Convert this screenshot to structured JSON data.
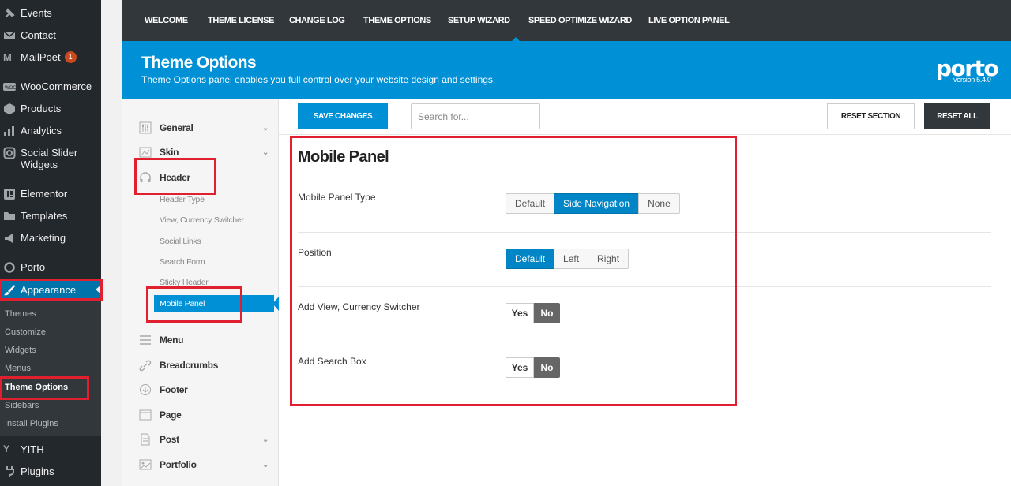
{
  "wp_menu": {
    "items": [
      {
        "label": "Events",
        "icon": "pin-icon"
      },
      {
        "label": "Contact",
        "icon": "mail-icon"
      },
      {
        "label": "MailPoet",
        "icon": "mailpoet-icon",
        "badge": "1"
      },
      {
        "label": "WooCommerce",
        "icon": "woocommerce-icon"
      },
      {
        "label": "Products",
        "icon": "box-icon"
      },
      {
        "label": "Analytics",
        "icon": "bar-chart-icon"
      },
      {
        "label": "Social Slider Widgets",
        "icon": "instagram-icon"
      },
      {
        "label": "Elementor",
        "icon": "elementor-icon"
      },
      {
        "label": "Templates",
        "icon": "folder-icon"
      },
      {
        "label": "Marketing",
        "icon": "megaphone-icon"
      },
      {
        "label": "Porto",
        "icon": "circle-icon"
      },
      {
        "label": "Appearance",
        "icon": "brush-icon"
      },
      {
        "label": "YITH",
        "icon": "yith-icon"
      },
      {
        "label": "Plugins",
        "icon": "plug-icon"
      }
    ],
    "submenu": [
      "Themes",
      "Customize",
      "Widgets",
      "Menus",
      "Theme Options",
      "Sidebars",
      "Install Plugins"
    ],
    "current_submenu": "Theme Options"
  },
  "topnav": {
    "tabs": [
      "WELCOME",
      "THEME LICENSE",
      "CHANGE LOG",
      "THEME OPTIONS",
      "SETUP WIZARD",
      "SPEED OPTIMIZE WIZARD",
      "LIVE OPTION PANEL",
      "!"
    ],
    "active": "THEME OPTIONS"
  },
  "banner": {
    "title": "Theme Options",
    "subtitle": "Theme Options panel enables you full control over your website design and settings.",
    "logo": "porto",
    "version": "version 5.4.0"
  },
  "options_menu": {
    "items": [
      {
        "label": "General",
        "icon": "sliders-icon"
      },
      {
        "label": "Skin",
        "icon": "image-icon"
      },
      {
        "label": "Header",
        "icon": "headphones-icon"
      },
      {
        "label": "Menu",
        "icon": "hamburger-icon"
      },
      {
        "label": "Breadcrumbs",
        "icon": "link-icon"
      },
      {
        "label": "Footer",
        "icon": "arrow-down-circle-icon"
      },
      {
        "label": "Page",
        "icon": "page-icon"
      },
      {
        "label": "Post",
        "icon": "document-icon"
      },
      {
        "label": "Portfolio",
        "icon": "picture-icon"
      }
    ],
    "header_sub": [
      "Header Type",
      "View, Currency Switcher",
      "Social Links",
      "Search Form",
      "Sticky Header",
      "Mobile Panel"
    ],
    "active_sub": "Mobile Panel"
  },
  "toolbar": {
    "save_label": "SAVE CHANGES",
    "search_placeholder": "Search for...",
    "reset_section_label": "RESET SECTION",
    "reset_all_label": "RESET ALL"
  },
  "section": {
    "title": "Mobile Panel",
    "fields": [
      {
        "label": "Mobile Panel Type",
        "options": [
          "Default",
          "Side Navigation",
          "None"
        ],
        "selected": "Side Navigation"
      },
      {
        "label": "Position",
        "options": [
          "Default",
          "Left",
          "Right"
        ],
        "selected": "Default"
      },
      {
        "label": "Add View, Currency Switcher",
        "options": [
          "Yes",
          "No"
        ],
        "selected": "No"
      },
      {
        "label": "Add Search Box",
        "options": [
          "Yes",
          "No"
        ],
        "selected": "No"
      }
    ]
  },
  "colors": {
    "accent": "#0090d6",
    "wp_sidebar": "#23282d",
    "annotation": "#e0202e"
  }
}
